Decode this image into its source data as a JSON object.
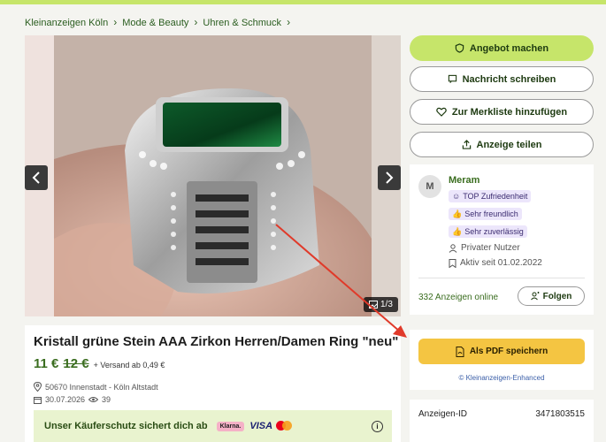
{
  "breadcrumb": [
    {
      "label": "Kleinanzeigen Köln"
    },
    {
      "label": "Mode & Beauty"
    },
    {
      "label": "Uhren & Schmuck"
    }
  ],
  "gallery": {
    "counter": "1/3",
    "image_alt": "Ring mit grünem Stein"
  },
  "actions": {
    "offer": "Angebot machen",
    "message": "Nachricht schreiben",
    "watchlist": "Zur Merkliste hinzufügen",
    "share": "Anzeige teilen"
  },
  "seller": {
    "avatar_initial": "M",
    "name": "Meram",
    "badges": [
      "TOP Zufriedenheit",
      "Sehr freundlich",
      "Sehr zuverlässig"
    ],
    "type": "Privater Nutzer",
    "active_since": "Aktiv seit 01.02.2022",
    "ads_online": "332 Anzeigen online",
    "follow": "Folgen"
  },
  "pdf": {
    "button": "Als PDF speichern",
    "credit": "© Kleinanzeigen-Enhanced"
  },
  "ad_id": {
    "label": "Anzeigen-ID",
    "value": "3471803515"
  },
  "listing": {
    "title": "Kristall grüne Stein AAA Zirkon Herren/Damen Ring \"neu\"",
    "price": "11 €",
    "old_price": "12 €",
    "shipping": "+ Versand ab 0,49 €",
    "location": "50670 Innenstadt - Köln Altstadt",
    "date": "30.07.2026",
    "views": "39"
  },
  "protection": {
    "text": "Unser Käuferschutz sichert dich ab",
    "klarna": "Klarna.",
    "visa": "VISA"
  },
  "colors": {
    "accent_green": "#c6e56a",
    "link_green": "#3a6d1f",
    "pdf_yellow": "#f4c542",
    "arrow_red": "#e03a2a"
  }
}
